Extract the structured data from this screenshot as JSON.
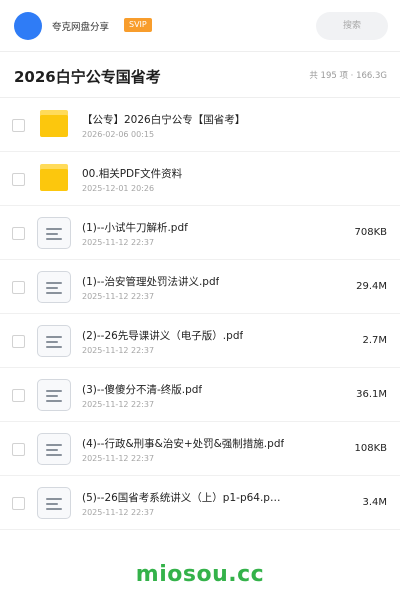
{
  "header": {
    "share_name": "夸克网盘分享",
    "vip_badge": "SVIP",
    "search_label": "搜索",
    "avatar_color": "#2f7cf6"
  },
  "title_bar": {
    "title": "2026白宁公专国省考",
    "stats": "共 195 项 · 166.3G"
  },
  "files": [
    {
      "type": "folder",
      "icon": "folder-icon",
      "name": "【公专】2026白宁公专【国省考】",
      "date": "2026-02-06 00:15",
      "size": ""
    },
    {
      "type": "folder",
      "icon": "folder-icon",
      "name": "00.相关PDF文件资料",
      "date": "2025-12-01 20:26",
      "size": ""
    },
    {
      "type": "file",
      "icon": "document-icon",
      "name": "(1)--小试牛刀解析.pdf",
      "date": "2025-11-12 22:37",
      "size": "708KB"
    },
    {
      "type": "file",
      "icon": "document-icon",
      "name": "(1)--治安管理处罚法讲义.pdf",
      "date": "2025-11-12 22:37",
      "size": "29.4M"
    },
    {
      "type": "file",
      "icon": "document-icon",
      "name": "(2)--26先导课讲义（电子版）.pdf",
      "date": "2025-11-12 22:37",
      "size": "2.7M"
    },
    {
      "type": "file",
      "icon": "document-icon",
      "name": "(3)--傻傻分不清-终版.pdf",
      "date": "2025-11-12 22:37",
      "size": "36.1M"
    },
    {
      "type": "file",
      "icon": "document-icon",
      "name": "(4)--行政&刑事&治安+处罚&强制措施.pdf",
      "date": "2025-11-12 22:37",
      "size": "108KB"
    },
    {
      "type": "file",
      "icon": "document-icon",
      "name": "(5)--26国省考系统讲义（上）p1-p64.p…",
      "date": "2025-11-12 22:37",
      "size": "3.4M"
    }
  ],
  "footer": {
    "watermark": "miosou.cc",
    "watermark_color": "#34b24a"
  },
  "colors": {
    "vip_badge": "#f89d2c",
    "folder": "#fcc70d"
  }
}
